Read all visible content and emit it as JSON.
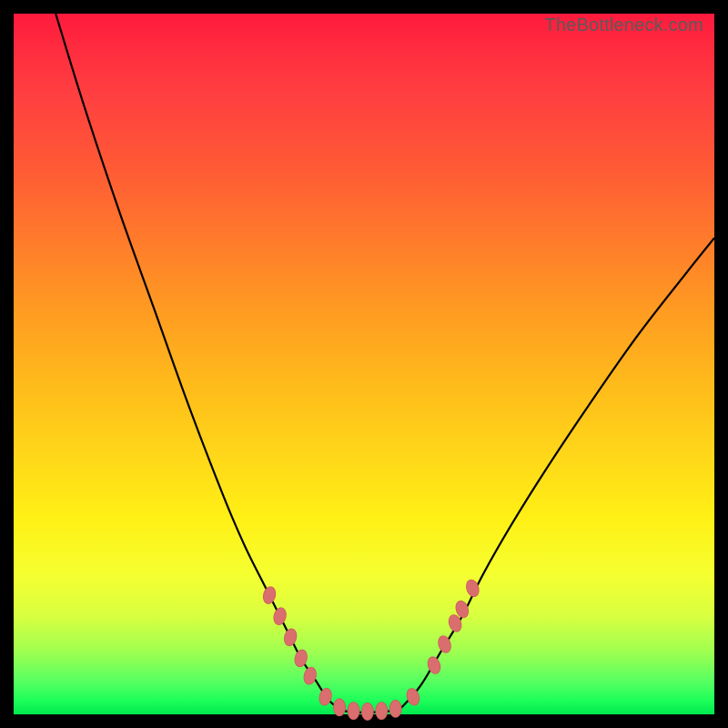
{
  "watermark": "TheBottleneck.com",
  "colors": {
    "frame": "#000000",
    "curve": "#000000",
    "marker_fill": "#da6e6e",
    "marker_stroke": "#c95b5b"
  },
  "chart_data": {
    "type": "line",
    "title": "",
    "xlabel": "",
    "ylabel": "",
    "xlim": [
      0,
      100
    ],
    "ylim": [
      0,
      100
    ],
    "grid": false,
    "legend": false,
    "note": "Values are estimated (%-scale) from the image; x runs left→right, y runs bottom→top. Minimum (~0) sits around x≈46–55.",
    "series": [
      {
        "name": "left-branch",
        "x": [
          6,
          10,
          15,
          20,
          25,
          30,
          33,
          36,
          39,
          41,
          43,
          45,
          47
        ],
        "y": [
          100,
          87,
          72,
          58,
          44,
          31,
          24,
          18,
          12,
          8,
          5,
          2,
          0.5
        ]
      },
      {
        "name": "valley-floor",
        "x": [
          47,
          49,
          51,
          53,
          55
        ],
        "y": [
          0.5,
          0.3,
          0.3,
          0.4,
          0.6
        ]
      },
      {
        "name": "right-branch",
        "x": [
          55,
          58,
          61,
          64,
          67,
          71,
          76,
          82,
          89,
          96,
          100
        ],
        "y": [
          0.6,
          4,
          9,
          14,
          20,
          27,
          35,
          44,
          54,
          63,
          68
        ]
      }
    ],
    "markers": {
      "note": "Salmon elongated dots along the curve near the valley",
      "points": [
        {
          "x": 36.5,
          "y": 17
        },
        {
          "x": 38.0,
          "y": 14
        },
        {
          "x": 39.5,
          "y": 11
        },
        {
          "x": 41.0,
          "y": 8
        },
        {
          "x": 42.3,
          "y": 5.5
        },
        {
          "x": 44.5,
          "y": 2.5
        },
        {
          "x": 46.5,
          "y": 1.0
        },
        {
          "x": 48.5,
          "y": 0.5
        },
        {
          "x": 50.5,
          "y": 0.4
        },
        {
          "x": 52.5,
          "y": 0.5
        },
        {
          "x": 54.5,
          "y": 0.8
        },
        {
          "x": 57.0,
          "y": 2.5
        },
        {
          "x": 60.0,
          "y": 7
        },
        {
          "x": 61.5,
          "y": 10
        },
        {
          "x": 63.0,
          "y": 13
        },
        {
          "x": 64.0,
          "y": 15
        },
        {
          "x": 65.5,
          "y": 18
        }
      ]
    }
  }
}
